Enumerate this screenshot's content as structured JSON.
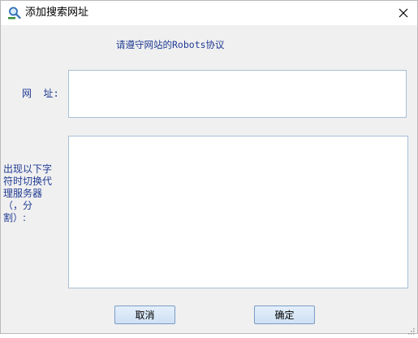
{
  "window": {
    "title": "添加搜索网址",
    "icon": "search-app-icon",
    "close_icon": "close-icon"
  },
  "notice": "请遵守网站的Robots协议",
  "url_field": {
    "label": "网  址:",
    "value": ""
  },
  "proxy_field": {
    "label": "出现以下字符时切换代理服务器（，分割）:",
    "value": ""
  },
  "buttons": {
    "cancel": "取消",
    "ok": "确定"
  },
  "colors": {
    "label_blue": "#1f3a93",
    "button_border": "#7a9cc6",
    "input_border": "#a9bfd6",
    "background": "#f0f0f0"
  }
}
